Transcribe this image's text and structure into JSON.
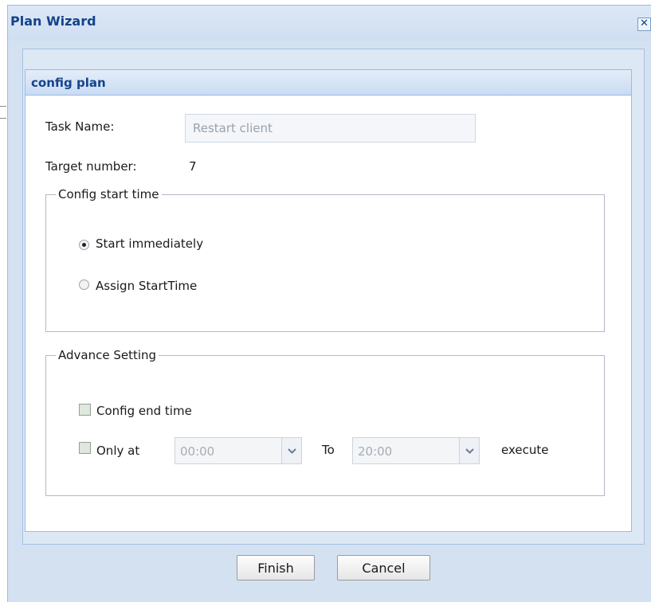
{
  "window": {
    "title": "Plan Wizard",
    "close_glyph": "✕"
  },
  "panel": {
    "title": "config plan"
  },
  "task": {
    "label": "Task Name:",
    "value": "Restart client"
  },
  "target": {
    "label": "Target number:",
    "value": "7"
  },
  "start_time": {
    "legend": "Config start time",
    "options": [
      {
        "label": "Start immediately",
        "checked": true
      },
      {
        "label": "Assign StartTime",
        "checked": false
      }
    ]
  },
  "advance": {
    "legend": "Advance Setting",
    "config_end_label": "Config end time",
    "only_at_label": "Only at",
    "from_value": "00:00",
    "to_label": "To",
    "to_value": "20:00",
    "execute_label": "execute"
  },
  "buttons": {
    "finish": "Finish",
    "cancel": "Cancel"
  },
  "icons": {
    "close": "close-icon",
    "dropdown": "chevron-down-icon"
  },
  "colors": {
    "title_text": "#15428b",
    "window_bg": "#d3e1f1"
  }
}
